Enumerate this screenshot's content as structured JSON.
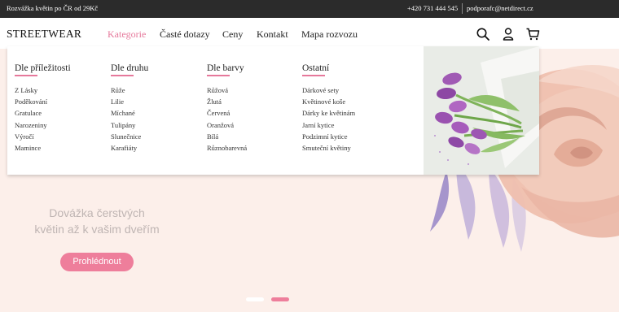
{
  "topbar": {
    "promo": "Rozvážka květin po ČR od 29Kč",
    "phone": "+420 731 444 545",
    "email": "podporafc@netdirect.cz"
  },
  "header": {
    "logo": "STREETWEAR",
    "nav": [
      "Kategorie",
      "Časté dotazy",
      "Ceny",
      "Kontakt",
      "Mapa rozvozu"
    ],
    "active_nav": "Kategorie",
    "icons": [
      "search-icon",
      "user-icon",
      "cart-icon"
    ]
  },
  "dropdown": {
    "columns": [
      {
        "title": "Dle příležitosti",
        "items": [
          "Z Lásky",
          "Poděkování",
          "Gratulace",
          "Narozeniny",
          "Výročí",
          "Mamince"
        ]
      },
      {
        "title": "Dle druhu",
        "items": [
          "Růže",
          "Lilie",
          "Míchané",
          "Tulipány",
          "Slunečnice",
          "Karafiáty"
        ]
      },
      {
        "title": "Dle barvy",
        "items": [
          "Růžová",
          "Žlutá",
          "Červená",
          "Oranžová",
          "Bílá",
          "Různobarevná"
        ]
      },
      {
        "title": "Ostatní",
        "items": [
          "Dárkové sety",
          "Květinové koše",
          "Dárky ke květinám",
          "Jarní kytice",
          "Podzimní kytice",
          "Smuteční květiny"
        ]
      }
    ]
  },
  "hero": {
    "line1": "Dovážka čerstvých",
    "line2": "květin až k vašim dveřím",
    "button": "Prohlédnout",
    "slides": 2,
    "active_slide": 2
  },
  "colors": {
    "accent": "#ee7e9b",
    "topbar_bg": "#2b2b2b",
    "hero_bg": "#fcefea"
  }
}
